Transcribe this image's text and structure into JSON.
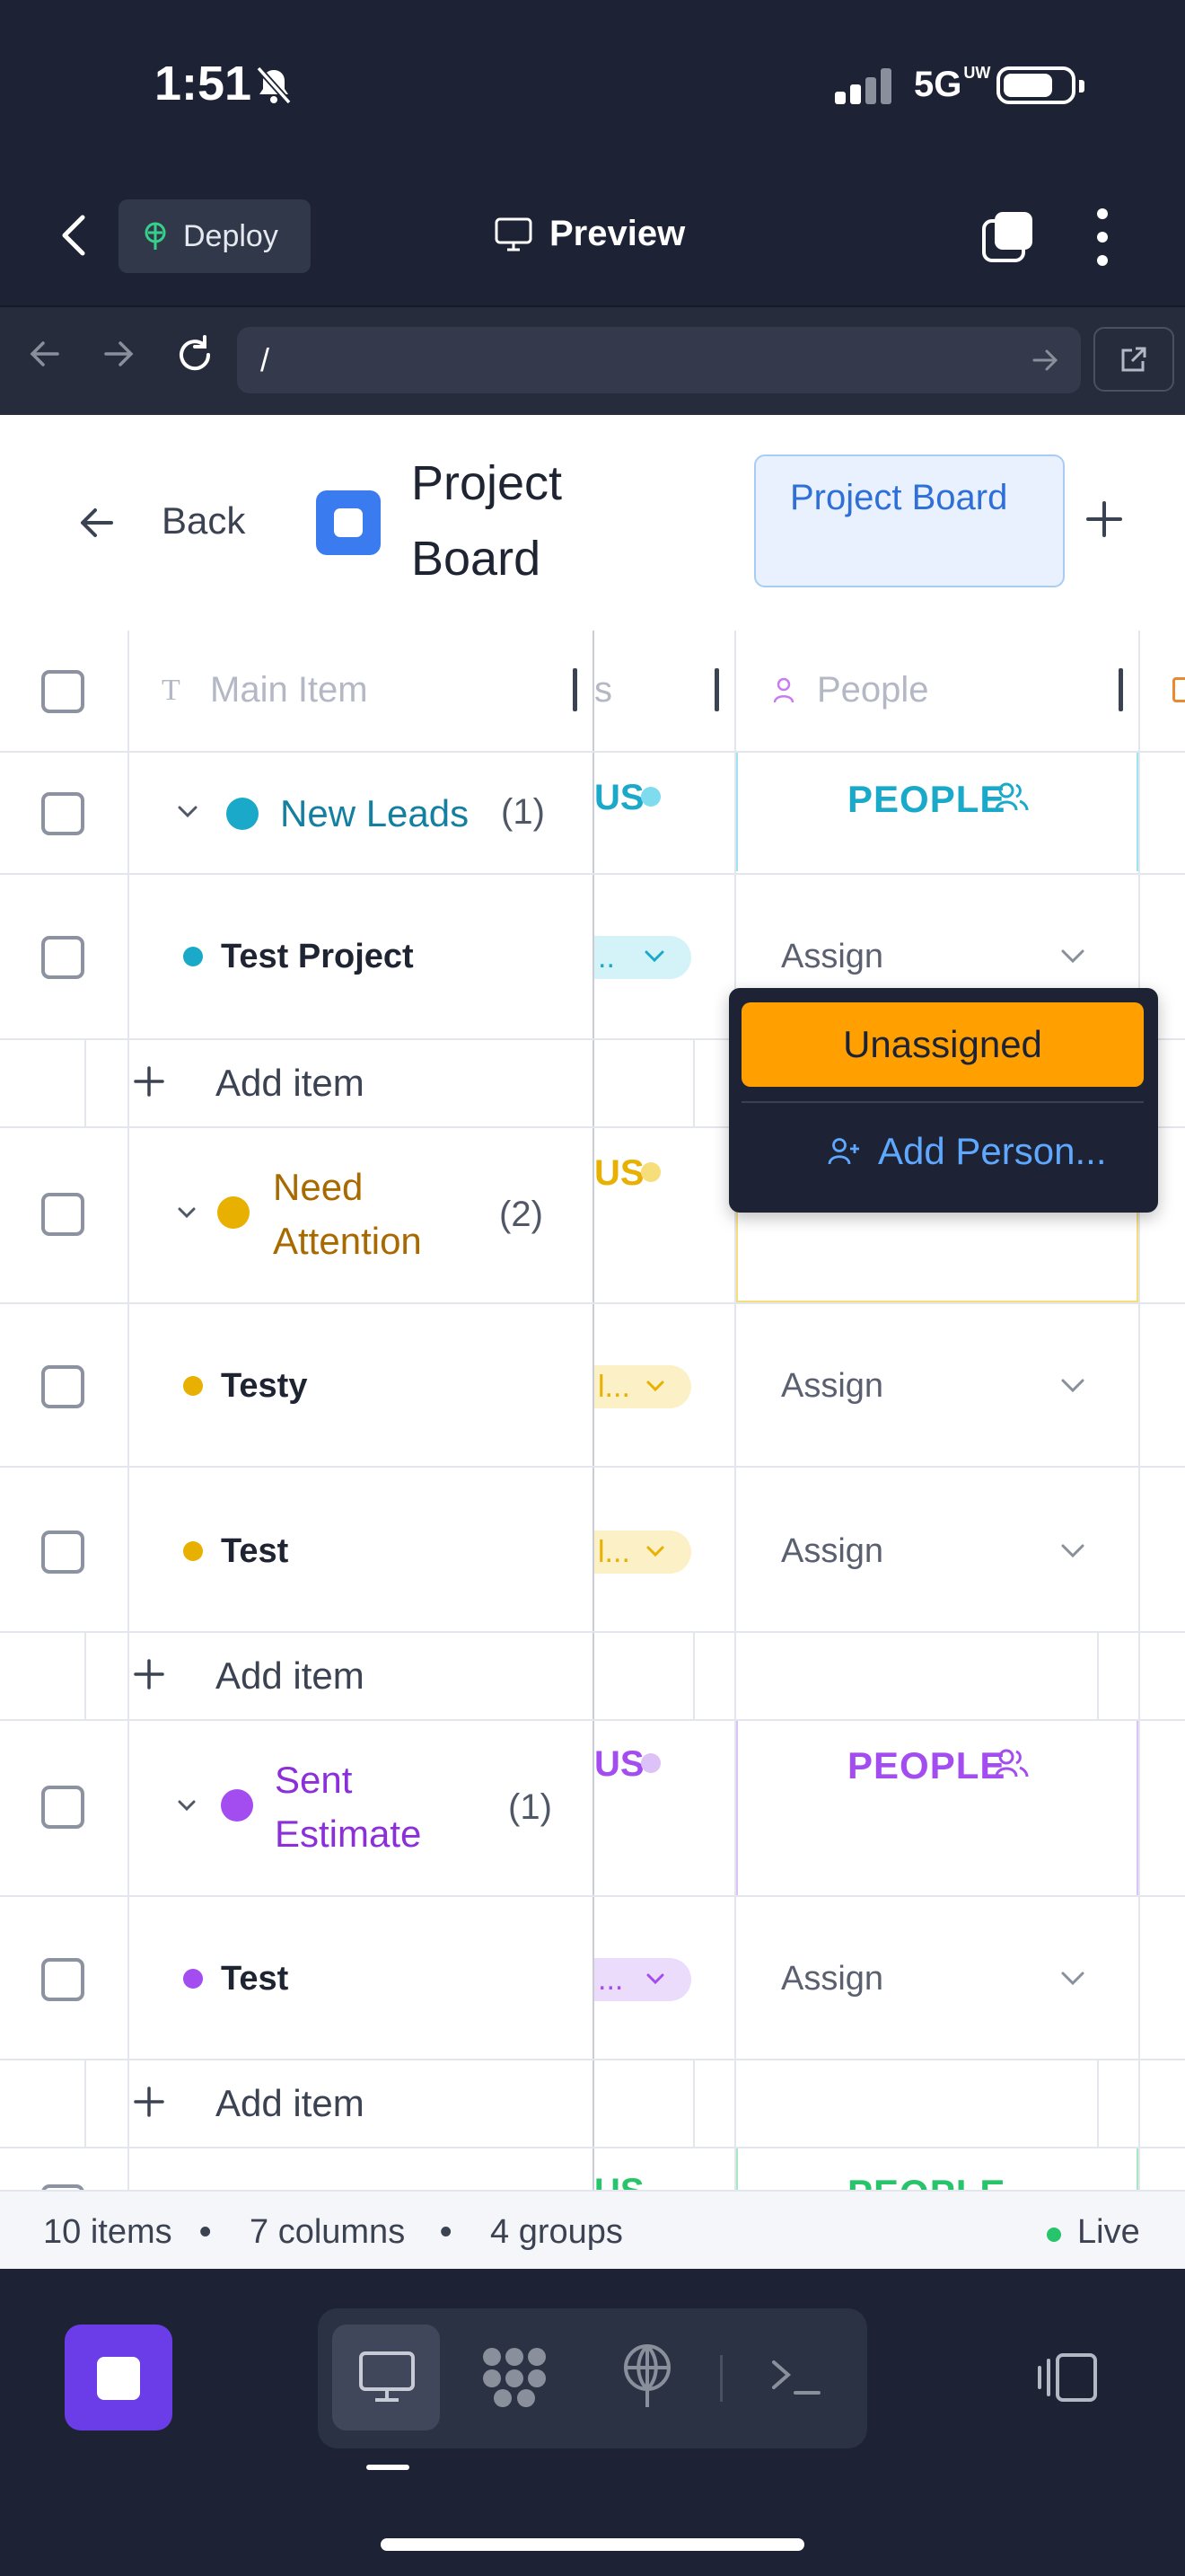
{
  "status_bar": {
    "time": "1:51",
    "network": "5G",
    "network_sub": "UW"
  },
  "browser": {
    "deploy_label": "Deploy",
    "preview_label": "Preview",
    "url": "/"
  },
  "app": {
    "back_label": "Back",
    "title": "Project Board",
    "chip_label": "Project Board"
  },
  "table": {
    "columns": {
      "main_item": "Main Item",
      "status_peek": "s",
      "people": "People"
    },
    "add_item_label": "Add item",
    "assign_label": "Assign",
    "people_header": "PEOPLE",
    "status_peek": "US",
    "groups": [
      {
        "name": "New Leads",
        "count": "(1)",
        "color": "#1aa9c9",
        "items": [
          "Test Project"
        ],
        "status_pill": ".."
      },
      {
        "name": "Need Attention",
        "count": "(2)",
        "color": "#e8a900",
        "items": [
          "Testy",
          "Test"
        ],
        "status_pill": "l..."
      },
      {
        "name": "Sent Estimate",
        "count": "(1)",
        "color": "#a34cf0",
        "items": [
          "Test"
        ],
        "status_pill": "..."
      },
      {
        "name_peek": "",
        "color": "#27c46b",
        "peek_status": "US",
        "peek_people": "PEOPLE"
      }
    ]
  },
  "dropdown": {
    "unassigned_label": "Unassigned",
    "add_person_label": "Add Person..."
  },
  "footer": {
    "items": "10 items",
    "columns": "7 columns",
    "groups": "4 groups",
    "live": "Live"
  },
  "colors": {
    "accent_blue": "#3a7bf0",
    "orange": "#ffa000",
    "stop_purple": "#6a3de8"
  }
}
